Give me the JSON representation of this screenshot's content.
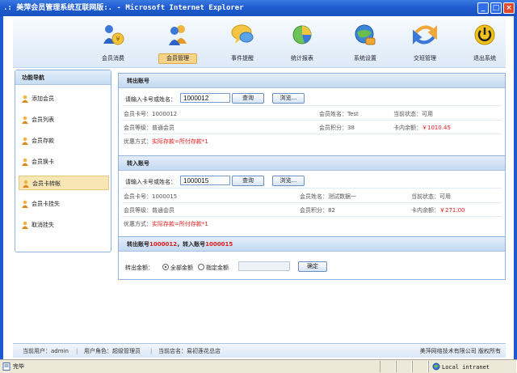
{
  "window": {
    "title": ".: 美萍会员管理系统互联网版:. - Microsoft Internet Explorer",
    "btn_min": "_",
    "btn_max": "□",
    "btn_close": "×"
  },
  "nav": {
    "items": [
      {
        "label": "会员消费",
        "icon": "coins-users-icon"
      },
      {
        "label": "会员管理",
        "icon": "users-icon"
      },
      {
        "label": "事件提醒",
        "icon": "speech-bubble-icon"
      },
      {
        "label": "统计报表",
        "icon": "pie-chart-icon"
      },
      {
        "label": "系统设置",
        "icon": "globe-settings-icon"
      },
      {
        "label": "交班管理",
        "icon": "arrow-swap-icon"
      },
      {
        "label": "退出系统",
        "icon": "power-icon"
      }
    ]
  },
  "sidebar": {
    "title": "功能导航",
    "items": [
      {
        "label": "添加会员",
        "icon": "user-add-icon"
      },
      {
        "label": "会员列表",
        "icon": "user-list-icon"
      },
      {
        "label": "会员存款",
        "icon": "user-deposit-icon"
      },
      {
        "label": "会员换卡",
        "icon": "user-card-icon"
      },
      {
        "label": "会员卡转帐",
        "icon": "user-transfer-icon"
      },
      {
        "label": "会员卡挂失",
        "icon": "user-lost-icon"
      },
      {
        "label": "取消挂失",
        "icon": "user-cancel-icon"
      }
    ]
  },
  "out": {
    "title": "转出账号",
    "search_label": "请输入卡号或姓名：",
    "search_value": "1000012",
    "query_btn": "查询",
    "browse_btn": "浏览...",
    "card_no": "会员卡号：1000012",
    "name": "会员姓名：Test",
    "status_label": "当前状态：",
    "status_value": "可用",
    "level": "会员等级：普通会员",
    "points": "会员积分：38",
    "balance_label": "卡内余额：",
    "balance_value": "￥1010.45",
    "discount_label": "优惠方式：",
    "discount_value": "实际存款=所付存款*1"
  },
  "in": {
    "title": "转入账号",
    "search_label": "请输入卡号或姓名：",
    "search_value": "1000015",
    "query_btn": "查询",
    "browse_btn": "浏览...",
    "card_no": "会员卡号：1000015",
    "name": "会员姓名：测试数据一",
    "status_label": "当前状态：",
    "status_value": "可用",
    "level": "会员等级：普通会员",
    "points": "会员积分：82",
    "balance_label": "卡内余额：",
    "balance_value": "￥271.00",
    "discount_label": "优惠方式：",
    "discount_value": "实际存款=所付存款*1"
  },
  "transfer": {
    "p1": "转出账号",
    "from": "1000012",
    "p2": "，转入账号",
    "to": "1000015",
    "amount_label": "转出金额：",
    "opt_all": "全部金额",
    "opt_custom": "指定金额",
    "amount_value": "",
    "confirm_btn": "确定"
  },
  "footer": {
    "user": "当前用户：admin",
    "role": "用户角色：超级管理员",
    "shop": "当前店名：易初莲花总店",
    "copyright": "美萍网络技术有限公司  版权所有"
  },
  "statusbar": {
    "left": "完毕",
    "zone": "Local intranet"
  }
}
